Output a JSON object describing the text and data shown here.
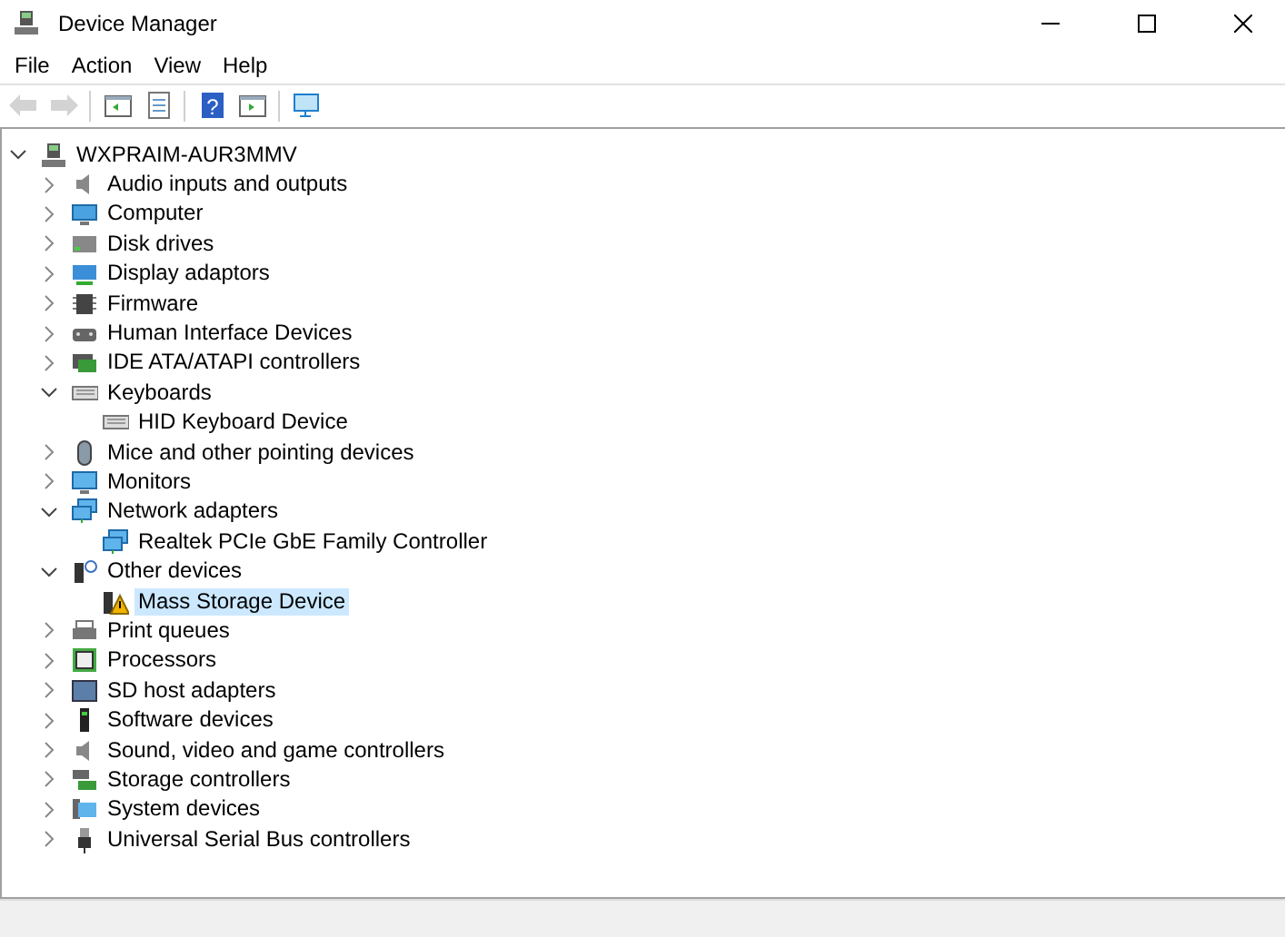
{
  "window": {
    "title": "Device Manager"
  },
  "menu": [
    "File",
    "Action",
    "View",
    "Help"
  ],
  "toolbar": [
    {
      "disabled": true
    },
    {
      "disabled": true
    },
    {
      "disabled": false
    },
    {
      "disabled": false
    },
    {
      "disabled": false,
      "glyph": "?"
    },
    {
      "disabled": false
    },
    {
      "disabled": false
    }
  ],
  "tree": {
    "label": "WXPRAIM-AUR3MMV",
    "expanded": true,
    "selected": false,
    "children": [
      {
        "label": "Audio inputs and outputs",
        "expanded": false,
        "selected": false
      },
      {
        "label": "Computer",
        "expanded": false,
        "selected": false
      },
      {
        "label": "Disk drives",
        "expanded": false,
        "selected": false
      },
      {
        "label": "Display adaptors",
        "expanded": false,
        "selected": false
      },
      {
        "label": "Firmware",
        "expanded": false,
        "selected": false
      },
      {
        "label": "Human Interface Devices",
        "expanded": false,
        "selected": false
      },
      {
        "label": "IDE ATA/ATAPI controllers",
        "expanded": false,
        "selected": false
      },
      {
        "label": "Keyboards",
        "expanded": true,
        "selected": false,
        "children": [
          {
            "label": "HID Keyboard Device",
            "selected": false
          }
        ]
      },
      {
        "label": "Mice and other pointing devices",
        "expanded": false,
        "selected": false
      },
      {
        "label": "Monitors",
        "expanded": false,
        "selected": false
      },
      {
        "label": "Network adapters",
        "expanded": true,
        "selected": false,
        "children": [
          {
            "label": "Realtek PCIe GbE Family Controller",
            "selected": false
          }
        ]
      },
      {
        "label": "Other devices",
        "expanded": true,
        "selected": false,
        "children": [
          {
            "label": "Mass Storage Device",
            "selected": true
          }
        ]
      },
      {
        "label": "Print queues",
        "expanded": false,
        "selected": false
      },
      {
        "label": "Processors",
        "expanded": false,
        "selected": false
      },
      {
        "label": "SD host adapters",
        "expanded": false,
        "selected": false
      },
      {
        "label": "Software devices",
        "expanded": false,
        "selected": false
      },
      {
        "label": "Sound, video and game controllers",
        "expanded": false,
        "selected": false
      },
      {
        "label": "Storage controllers",
        "expanded": false,
        "selected": false
      },
      {
        "label": "System devices",
        "expanded": false,
        "selected": false
      },
      {
        "label": "Universal Serial Bus controllers",
        "expanded": false,
        "selected": false
      }
    ]
  }
}
